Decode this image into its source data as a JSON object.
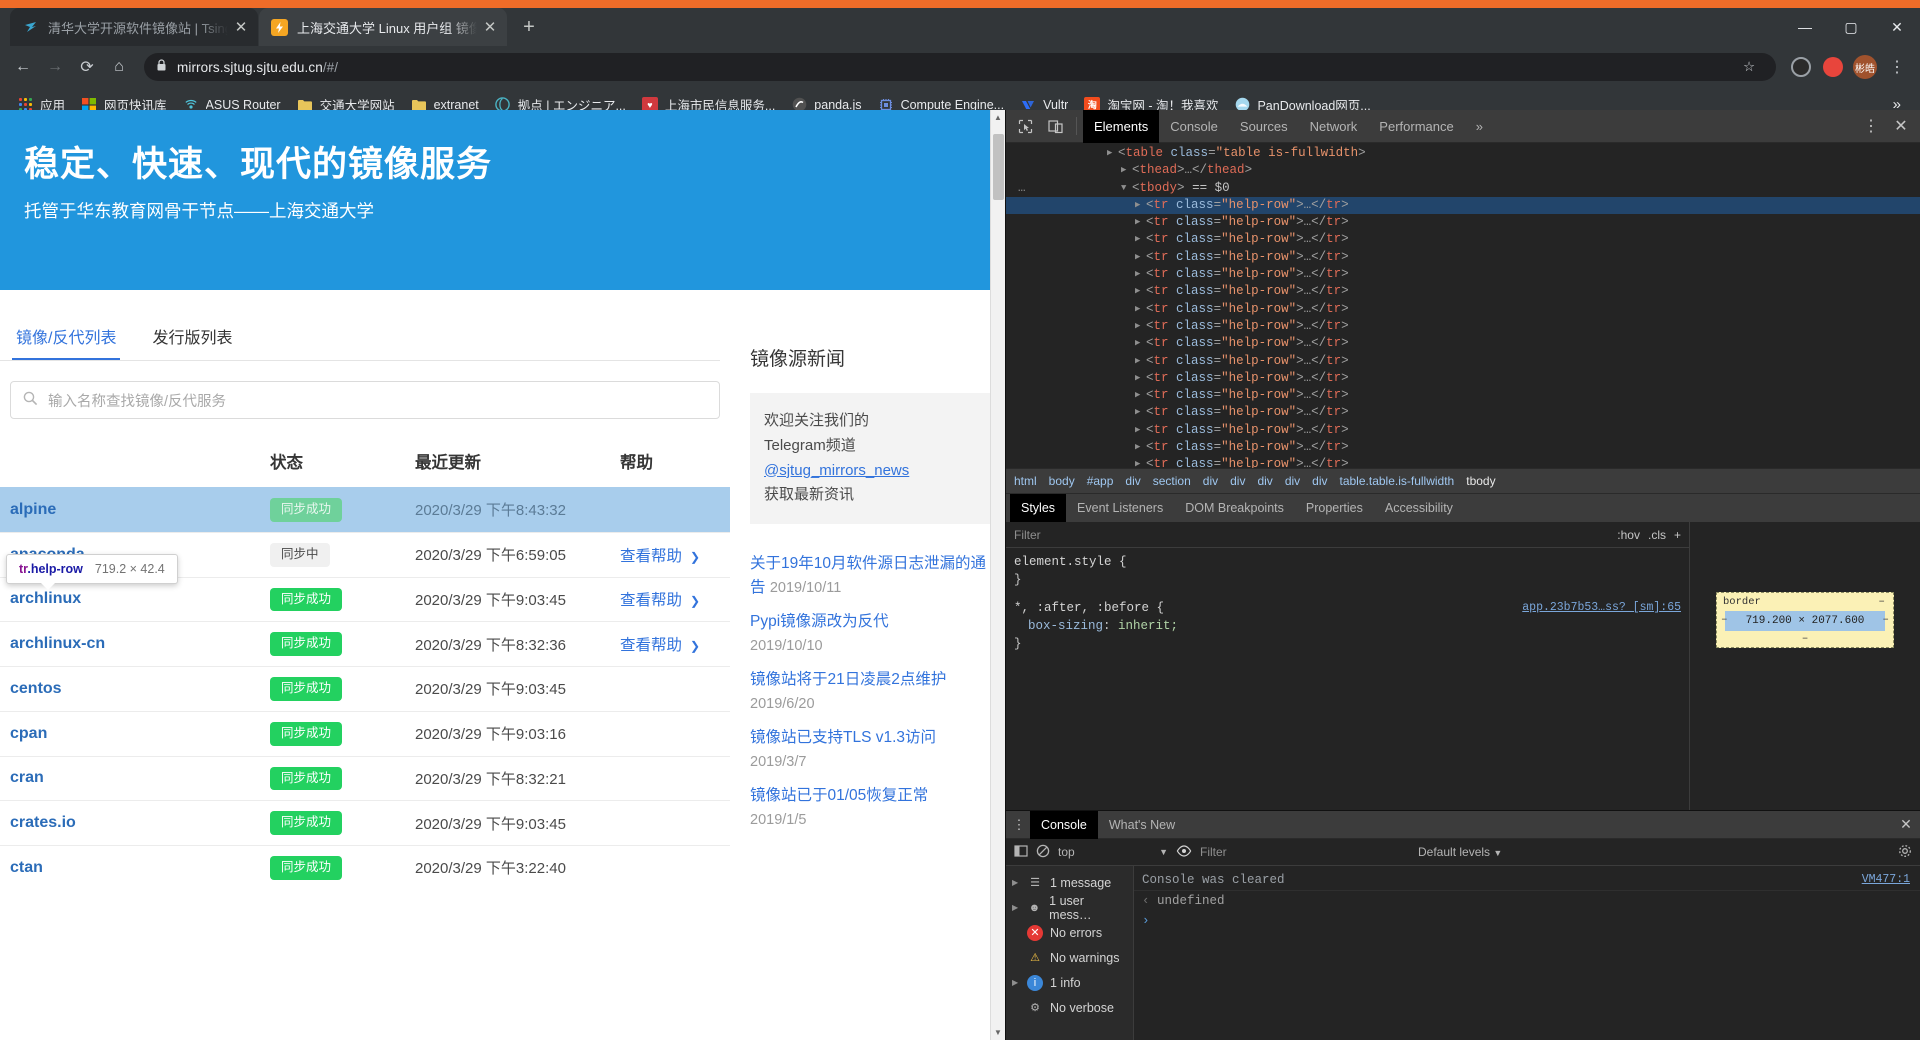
{
  "browser": {
    "tabs": [
      {
        "title": "清华大学开源软件镜像站 | Tsing",
        "favicon": "tsinghua-icon",
        "active": false
      },
      {
        "title": "上海交通大学 Linux 用户组 镜像",
        "favicon": "sjtug-icon",
        "active": true
      }
    ],
    "new_tab_label": "+",
    "window_controls": {
      "minimize": "—",
      "maximize": "▢",
      "close": "✕"
    },
    "toolbar": {
      "back": "←",
      "forward": "→",
      "reload": "⟳",
      "home": "⌂",
      "lock_icon": "lock-icon",
      "url": "mirrors.sjtug.sjtu.edu.cn",
      "url_path": "/#/",
      "star": "☆",
      "profile_initials": "彬皓"
    },
    "bookmarks": [
      {
        "label": "应用",
        "icon": "apps-grid-icon"
      },
      {
        "label": "网页快讯库",
        "icon": "microsoft-icon"
      },
      {
        "label": "ASUS Router",
        "icon": "wifi-icon"
      },
      {
        "label": "交通大学网站",
        "icon": "folder-icon"
      },
      {
        "label": "extranet",
        "icon": "folder-icon"
      },
      {
        "label": "拠点 | エンジニア...",
        "icon": "globe-icon"
      },
      {
        "label": "上海市民信息服务...",
        "icon": "shanghai-icon"
      },
      {
        "label": "panda.js",
        "icon": "panda-icon"
      },
      {
        "label": "Compute Engine...",
        "icon": "chip-icon"
      },
      {
        "label": "Vultr",
        "icon": "vultr-icon"
      },
      {
        "label": "淘宝网 - 淘！我喜欢",
        "icon": "taobao-icon"
      },
      {
        "label": "PanDownload网页...",
        "icon": "cloud-icon"
      }
    ],
    "bookmarks_overflow": "»"
  },
  "page": {
    "hero": {
      "title": "稳定、快速、现代的镜像服务",
      "subtitle": "托管于华东教育网骨干节点——上海交通大学"
    },
    "tabs": [
      {
        "label": "镜像/反代列表",
        "active": true
      },
      {
        "label": "发行版列表",
        "active": false
      }
    ],
    "search": {
      "placeholder": "输入名称查找镜像/反代服务",
      "value": "",
      "icon": "search-icon"
    },
    "table": {
      "headers": [
        "",
        "状态",
        "最近更新",
        "帮助"
      ],
      "help_link_label": "查看帮助",
      "rows": [
        {
          "name": "alpine",
          "status": "同步成功",
          "status_type": "ok",
          "updated": "2020/3/29 下午8:43:32",
          "help": false,
          "highlighted": true
        },
        {
          "name": "anaconda",
          "status": "同步中",
          "status_type": "syncing",
          "updated": "2020/3/29 下午6:59:05",
          "help": true,
          "highlighted": false
        },
        {
          "name": "archlinux",
          "status": "同步成功",
          "status_type": "ok",
          "updated": "2020/3/29 下午9:03:45",
          "help": true,
          "highlighted": false
        },
        {
          "name": "archlinux-cn",
          "status": "同步成功",
          "status_type": "ok",
          "updated": "2020/3/29 下午8:32:36",
          "help": true,
          "highlighted": false
        },
        {
          "name": "centos",
          "status": "同步成功",
          "status_type": "ok",
          "updated": "2020/3/29 下午9:03:45",
          "help": false,
          "highlighted": false
        },
        {
          "name": "cpan",
          "status": "同步成功",
          "status_type": "ok",
          "updated": "2020/3/29 下午9:03:16",
          "help": false,
          "highlighted": false
        },
        {
          "name": "cran",
          "status": "同步成功",
          "status_type": "ok",
          "updated": "2020/3/29 下午8:32:21",
          "help": false,
          "highlighted": false
        },
        {
          "name": "crates.io",
          "status": "同步成功",
          "status_type": "ok",
          "updated": "2020/3/29 下午9:03:45",
          "help": false,
          "highlighted": false
        },
        {
          "name": "ctan",
          "status": "同步成功",
          "status_type": "ok",
          "updated": "2020/3/29 下午3:22:40",
          "help": false,
          "highlighted": false
        }
      ]
    },
    "element_tooltip": {
      "tag": "tr",
      "class": ".help-row",
      "dimensions": "719.2 × 42.4"
    },
    "news": {
      "title": "镜像源新闻",
      "box": {
        "line1": "欢迎关注我们的",
        "line2": "Telegram频道",
        "link": "@sjtug_mirrors_news",
        "line4": "获取最新资讯"
      },
      "items": [
        {
          "title": "关于19年10月软件源日志泄漏的通告",
          "date": "2019/10/11",
          "inline_date": true
        },
        {
          "title": "Pypi镜像源改为反代",
          "date": "2019/10/10",
          "inline_date": false
        },
        {
          "title": "镜像站将于21日凌晨2点维护",
          "date": "2019/6/20",
          "inline_date": false
        },
        {
          "title": "镜像站已支持TLS v1.3访问",
          "date": "2019/3/7",
          "inline_date": false
        },
        {
          "title": "镜像站已于01/05恢复正常",
          "date": "2019/1/5",
          "inline_date": false
        }
      ]
    },
    "scrollbar": {
      "up": "▲",
      "down": "▼"
    }
  },
  "devtools": {
    "toolbar_icons": [
      "inspect-element-icon",
      "device-toolbar-icon"
    ],
    "tabs": [
      {
        "label": "Elements",
        "active": true
      },
      {
        "label": "Console",
        "active": false
      },
      {
        "label": "Sources",
        "active": false
      },
      {
        "label": "Network",
        "active": false
      },
      {
        "label": "Performance",
        "active": false
      }
    ],
    "overflow": "»",
    "settings_icon": "kebab-menu-icon",
    "close_icon": "close-icon",
    "dom": {
      "top_lines": [
        {
          "indent": 1,
          "arrow": "▶",
          "text": "<table class=\"table is-fullwidth>",
          "type": "partial"
        },
        {
          "indent": 2,
          "arrow": "▶",
          "text": "<thead>…</thead>",
          "type": "normal"
        }
      ],
      "tbody_line": {
        "arrow": "▼",
        "tag": "tbody",
        "marker": "== $0",
        "dots": "..."
      },
      "row_count": 17,
      "row_markup": "<tr class=\"help-row\">…</tr>",
      "selected_row_index": 0
    },
    "breadcrumb": [
      "html",
      "body",
      "#app",
      "div",
      "section",
      "div",
      "div",
      "div",
      "div",
      "div",
      "table.table.is-fullwidth",
      "tbody"
    ],
    "sub_tabs": [
      {
        "label": "Styles",
        "active": true
      },
      {
        "label": "Event Listeners",
        "active": false
      },
      {
        "label": "DOM Breakpoints",
        "active": false
      },
      {
        "label": "Properties",
        "active": false
      },
      {
        "label": "Accessibility",
        "active": false
      }
    ],
    "styles": {
      "filter_placeholder": "Filter",
      "hov": ":hov",
      "cls": ".cls",
      "add_rule": "+",
      "rules": [
        {
          "selector": "element.style {",
          "close": "}",
          "props": []
        },
        {
          "selector": "*, :after, :before {",
          "source": "app.23b7b53…ss? [sm]:65",
          "close": "}",
          "props": [
            {
              "name": "box-sizing",
              "value": "inherit;"
            }
          ]
        }
      ]
    },
    "box_model": {
      "border_label": "border",
      "border_dash": "–",
      "content": "719.200 × 2077.600"
    },
    "drawer": {
      "tabs": [
        {
          "label": "Console",
          "active": true
        },
        {
          "label": "What's New",
          "active": false
        }
      ],
      "close_icon": "close-icon",
      "toolbar": {
        "clear_icon": "clear-console-icon",
        "sidebar_icon": "console-sidebar-icon",
        "context": "top",
        "eye_icon": "live-expression-icon",
        "filter_placeholder": "Filter",
        "levels": "Default levels",
        "settings_icon": "gear-icon"
      },
      "issues": [
        {
          "label": "1 message",
          "icon": "messages-icon",
          "expandable": true
        },
        {
          "label": "1 user mess…",
          "icon": "user-message-icon",
          "expandable": true
        },
        {
          "label": "No errors",
          "icon": "error-icon",
          "expandable": false
        },
        {
          "label": "No warnings",
          "icon": "warning-icon",
          "expandable": false
        },
        {
          "label": "1 info",
          "icon": "info-icon",
          "expandable": true
        },
        {
          "label": "No verbose",
          "icon": "verbose-icon",
          "expandable": false
        }
      ],
      "log": [
        {
          "text": "Console was cleared",
          "source": "VM477:1"
        },
        {
          "text": "undefined",
          "prefix": "‹",
          "source": ""
        }
      ],
      "prompt": "›"
    }
  },
  "colors": {
    "brand_blue": "#2196dd",
    "link_blue": "#3273dc",
    "success_green": "#23d160",
    "highlight_row": "#a8cdec",
    "chrome_orange": "#ef6c28"
  }
}
